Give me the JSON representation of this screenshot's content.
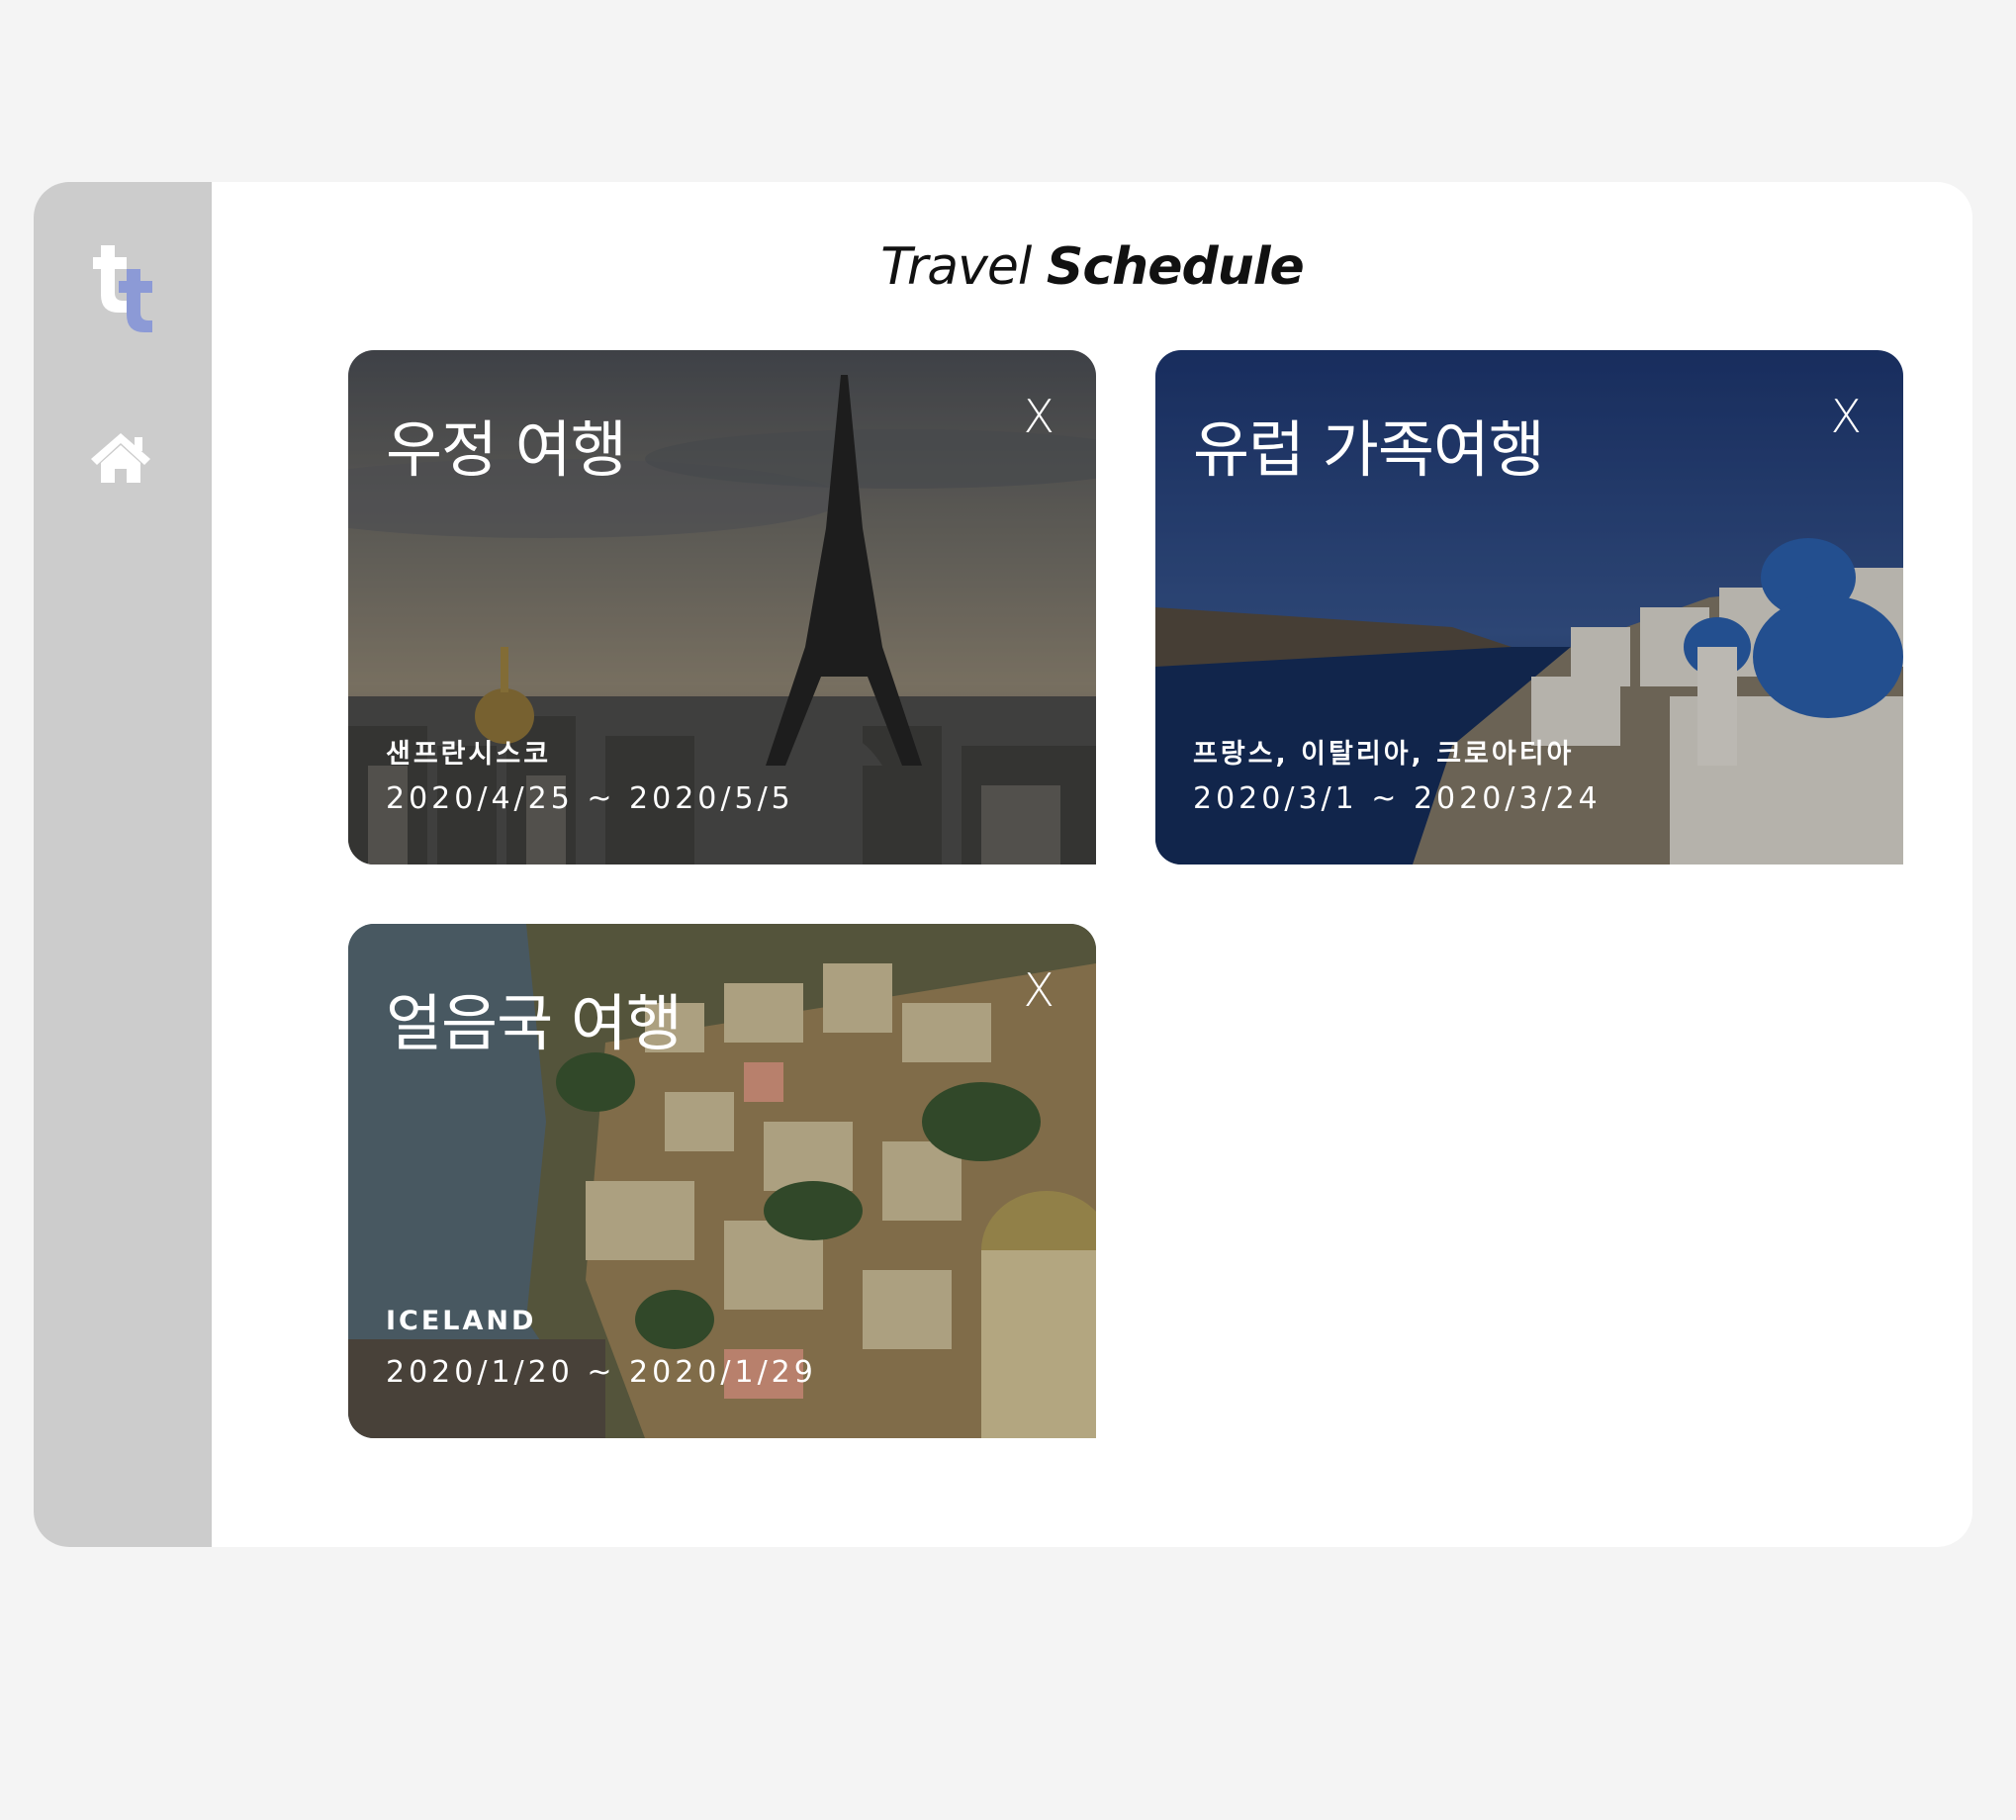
{
  "header": {
    "title_light": "Travel",
    "title_bold": "Schedule"
  },
  "sidebar": {
    "logo_icon": "tt-logo-icon",
    "home_icon": "home-icon",
    "logo_colors": [
      "#ffffff",
      "#8c9ad6"
    ]
  },
  "trips": [
    {
      "title": "우정 여행",
      "place": "샌프란시스코",
      "dates": "2020/4/25 ~ 2020/5/5",
      "close": "X",
      "scene": "eiffel-tower-paris"
    },
    {
      "title": "유럽 가족여행",
      "place": "프랑스, 이탈리아, 크로아티아",
      "dates": "2020/3/1 ~ 2020/3/24",
      "close": "X",
      "scene": "santorini-blue-domes"
    },
    {
      "title": "얼음국 여행",
      "place": "ICELAND",
      "dates": "2020/1/20 ~ 2020/1/29",
      "close": "X",
      "scene": "amalfi-coast-town"
    }
  ]
}
